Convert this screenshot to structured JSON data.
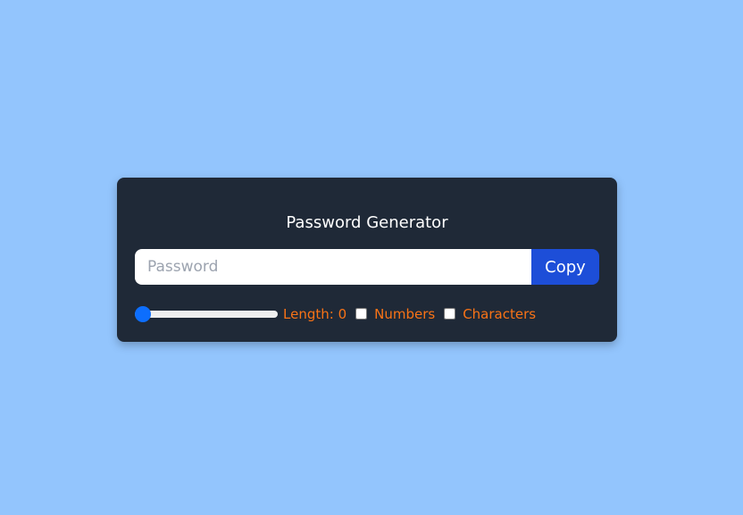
{
  "app": {
    "title": "Password Generator"
  },
  "password": {
    "value": "",
    "placeholder": "Password"
  },
  "copy_button": {
    "label": "Copy"
  },
  "length": {
    "label_prefix": "Length: ",
    "value": 0,
    "min": 0,
    "max": 100
  },
  "options": {
    "numbers": {
      "label": "Numbers",
      "checked": false
    },
    "characters": {
      "label": "Characters",
      "checked": false
    }
  },
  "colors": {
    "background": "#93c5fd",
    "card": "#1f2937",
    "title": "#ffffff",
    "accent_button": "#1d4ed8",
    "label_text": "#f97316",
    "slider_thumb": "#0d6efd"
  }
}
